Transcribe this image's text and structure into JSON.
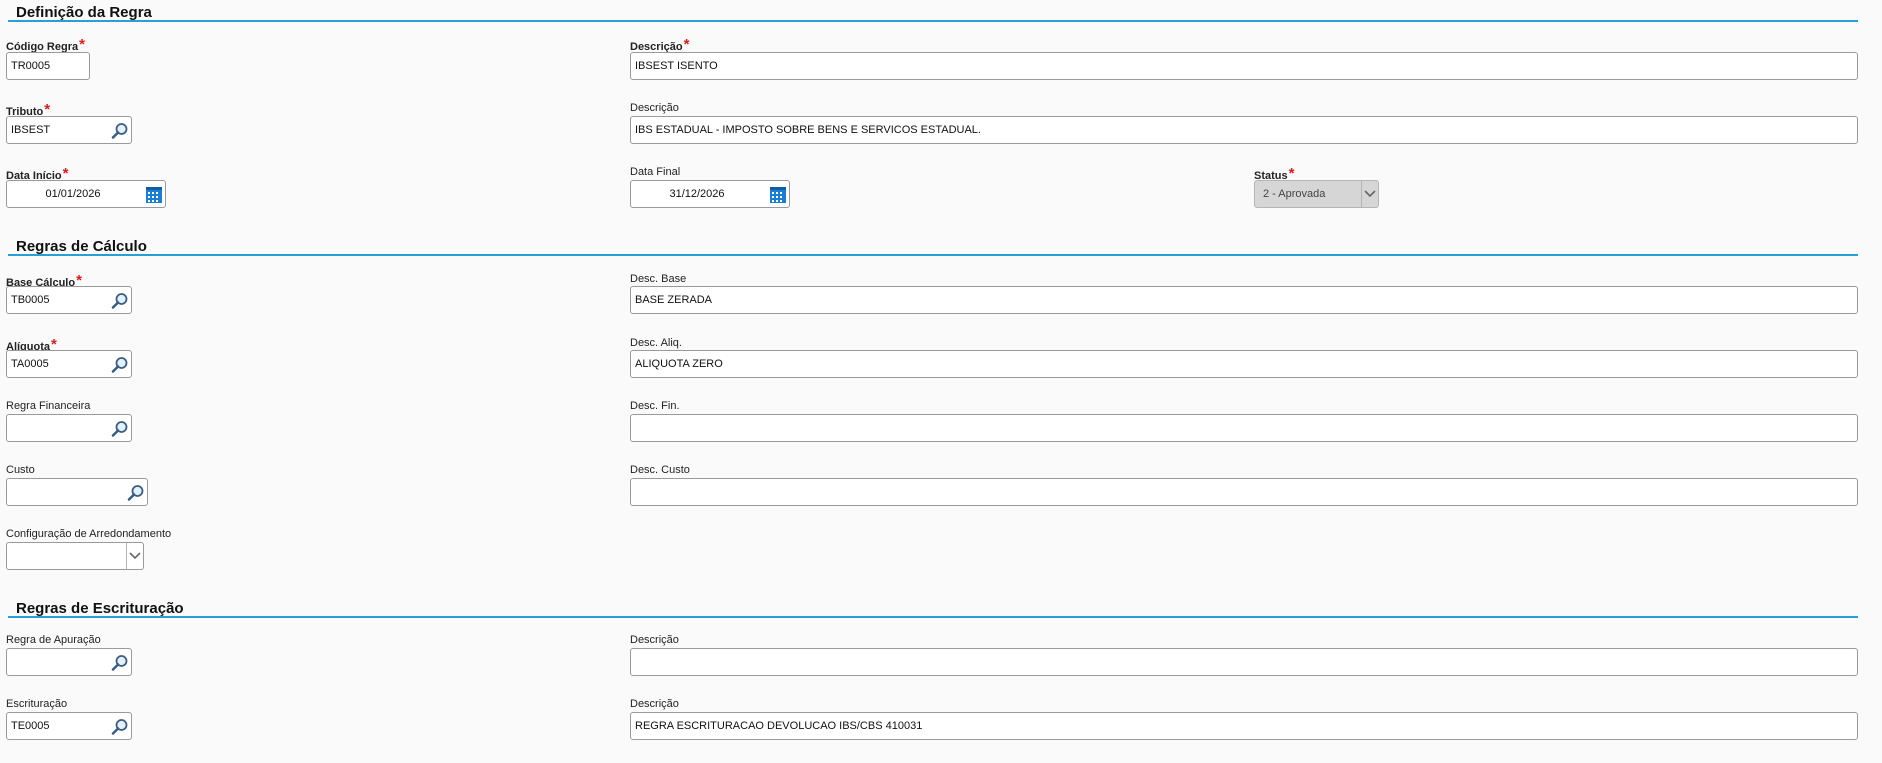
{
  "sections": {
    "definicao": "Definição da Regra",
    "calculo": "Regras de Cálculo",
    "escrituracao": "Regras de Escrituração"
  },
  "fields": {
    "codigo_regra": {
      "label": "Código Regra",
      "value": "TR0005"
    },
    "descricao_regra": {
      "label": "Descrição",
      "value": "IBSEST ISENTO"
    },
    "tributo": {
      "label": "Tributo",
      "value": "IBSEST"
    },
    "descricao_tributo": {
      "label": "Descrição",
      "value": "IBS ESTADUAL - IMPOSTO SOBRE BENS E SERVICOS ESTADUAL."
    },
    "data_inicio": {
      "label": "Data Início",
      "value": "01/01/2026"
    },
    "data_final": {
      "label": "Data Final",
      "value": "31/12/2026"
    },
    "status": {
      "label": "Status",
      "value": "2 - Aprovada"
    },
    "base_calculo": {
      "label": "Base Cálculo",
      "value": "TB0005"
    },
    "desc_base": {
      "label": "Desc. Base",
      "value": "BASE ZERADA"
    },
    "aliquota": {
      "label": "Alíquota",
      "value": "TA0005"
    },
    "desc_aliq": {
      "label": "Desc. Aliq.",
      "value": "ALIQUOTA ZERO"
    },
    "regra_financeira": {
      "label": "Regra Financeira",
      "value": ""
    },
    "desc_fin": {
      "label": "Desc. Fin.",
      "value": ""
    },
    "custo": {
      "label": "Custo",
      "value": ""
    },
    "desc_custo": {
      "label": "Desc. Custo",
      "value": ""
    },
    "config_arredondamento": {
      "label": "Configuração de Arredondamento",
      "value": ""
    },
    "regra_apuracao": {
      "label": "Regra de Apuração",
      "value": ""
    },
    "descricao_apuracao": {
      "label": "Descrição",
      "value": ""
    },
    "escrituracao": {
      "label": "Escrituração",
      "value": "TE0005"
    },
    "descricao_escrituracao": {
      "label": "Descrição",
      "value": "REGRA ESCRITURACAO DEVOLUCAO IBS/CBS 410031"
    }
  },
  "required_marker": "*",
  "colors": {
    "accent": "#2a9fd6",
    "required": "#e01a1a"
  },
  "icons": {
    "lookup": "search-icon",
    "date": "calendar-icon",
    "dropdown": "chevron-down-icon"
  }
}
